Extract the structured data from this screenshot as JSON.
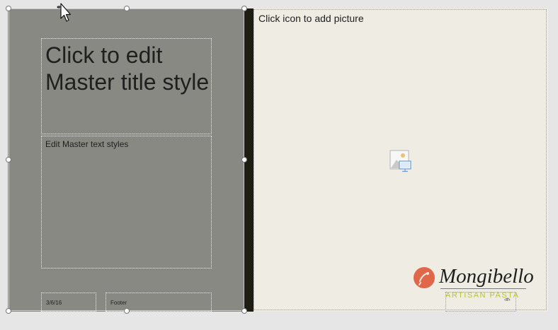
{
  "slide": {
    "title_placeholder": "Click to edit Master title style",
    "body_placeholder": "Edit Master text styles",
    "date": "3/6/16",
    "footer": "Footer",
    "page_number": "‹#›",
    "picture_placeholder": "Click icon to add picture",
    "picture_icon": "picture-icon"
  },
  "logo": {
    "name": "Mongibello",
    "tagline": "ARTISAN PASTA"
  },
  "colors": {
    "left_panel": "#898983",
    "divider": "#1d1d14",
    "slide_background": "#efece4",
    "logo_accent": "#e0674a",
    "tagline": "#b9c23a"
  },
  "cursor_icon": "move-cursor-icon"
}
